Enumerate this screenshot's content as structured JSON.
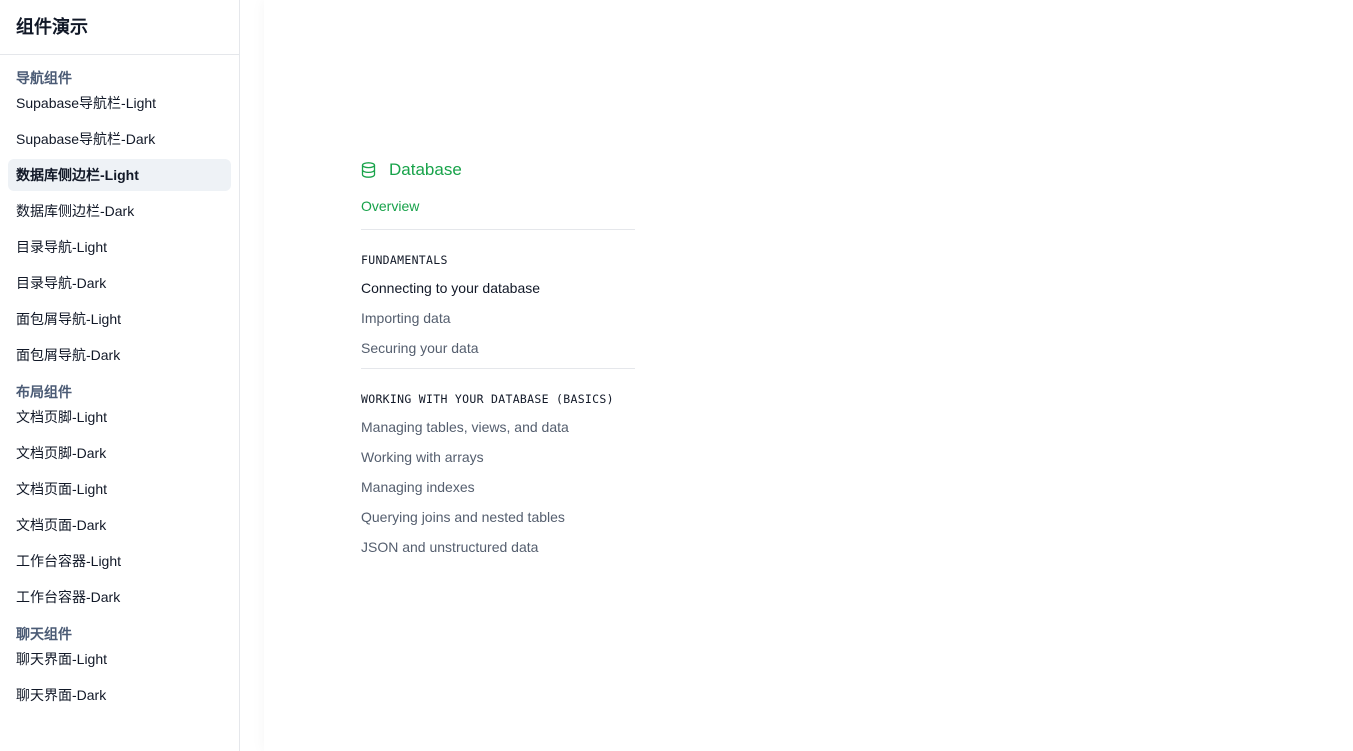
{
  "sidebar": {
    "title": "组件演示",
    "groups": [
      {
        "label": "导航组件",
        "items": [
          {
            "label": "Supabase导航栏-Light"
          },
          {
            "label": "Supabase导航栏-Dark"
          },
          {
            "label": "数据库侧边栏-Light",
            "active": true
          },
          {
            "label": "数据库侧边栏-Dark"
          },
          {
            "label": "目录导航-Light"
          },
          {
            "label": "目录导航-Dark"
          },
          {
            "label": "面包屑导航-Light"
          },
          {
            "label": "面包屑导航-Dark"
          }
        ]
      },
      {
        "label": "布局组件",
        "items": [
          {
            "label": "文档页脚-Light"
          },
          {
            "label": "文档页脚-Dark"
          },
          {
            "label": "文档页面-Light"
          },
          {
            "label": "文档页面-Dark"
          },
          {
            "label": "工作台容器-Light"
          },
          {
            "label": "工作台容器-Dark"
          }
        ]
      },
      {
        "label": "聊天组件",
        "items": [
          {
            "label": "聊天界面-Light"
          },
          {
            "label": "聊天界面-Dark"
          }
        ]
      }
    ]
  },
  "preview": {
    "header": {
      "icon": "database-icon",
      "title": "Database"
    },
    "overview_label": "Overview",
    "sections": [
      {
        "title": "FUNDAMENTALS",
        "links": [
          {
            "label": "Connecting to your database",
            "current": true
          },
          {
            "label": "Importing data"
          },
          {
            "label": "Securing your data"
          }
        ]
      },
      {
        "title": "WORKING WITH YOUR DATABASE (BASICS)",
        "links": [
          {
            "label": "Managing tables, views, and data"
          },
          {
            "label": "Working with arrays"
          },
          {
            "label": "Managing indexes"
          },
          {
            "label": "Querying joins and nested tables"
          },
          {
            "label": "JSON and unstructured data"
          }
        ]
      }
    ]
  },
  "colors": {
    "accent_green": "#18a34a",
    "active_bg": "#eef2f6",
    "group_label": "#4b5b75",
    "muted_link": "#545e6e"
  }
}
